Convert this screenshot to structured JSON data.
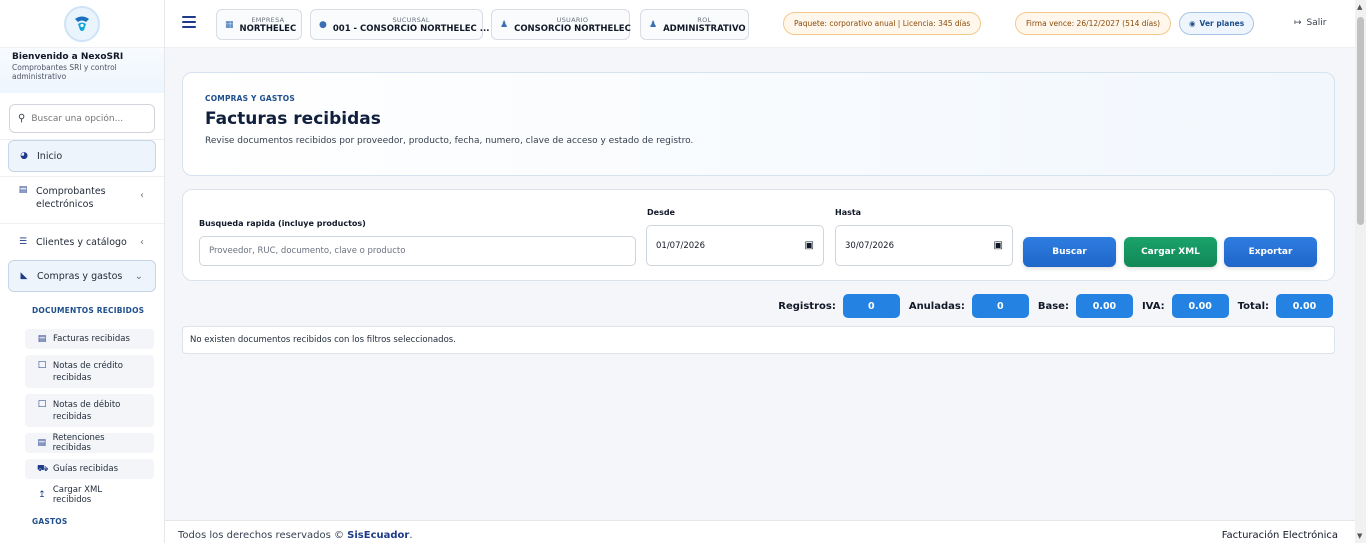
{
  "sidebar": {
    "welcome_title": "Bienvenido a NexoSRI",
    "welcome_subtitle": "Comprobantes SRI y control administrativo",
    "search_placeholder": "Buscar una opción...",
    "items": [
      {
        "label": "Inicio",
        "icon": "dashboard-icon"
      },
      {
        "label": "Comprobantes electrónicos",
        "icon": "document-icon"
      },
      {
        "label": "Clientes y catálogo",
        "icon": "list-icon"
      },
      {
        "label": "Compras y gastos",
        "icon": "cart-icon"
      }
    ],
    "section_received": "DOCUMENTOS RECIBIDOS",
    "sub_items": [
      {
        "label": "Facturas recibidas",
        "icon": "invoice-icon"
      },
      {
        "label": "Notas de crédito recibidas",
        "icon": "file-icon"
      },
      {
        "label": "Notas de débito recibidas",
        "icon": "file-icon"
      },
      {
        "label": "Retenciones recibidas",
        "icon": "invoice-icon"
      },
      {
        "label": "Guías recibidas",
        "icon": "truck-icon"
      },
      {
        "label": "Cargar XML recibidos",
        "icon": "upload-icon"
      }
    ],
    "section_expenses": "GASTOS"
  },
  "topbar": {
    "empresa_label": "EMPRESA",
    "empresa_value": "NORTHELEC",
    "sucursal_label": "SUCURSAL",
    "sucursal_value": "001 - CONSORCIO NORTHELEC ...",
    "usuario_label": "USUARIO",
    "usuario_value": "CONSORCIO NORTHELEC",
    "rol_label": "ROL",
    "rol_value": "ADMINISTRATIVO",
    "package_badge": "Paquete: corporativo anual | Licencia: 345 días",
    "signature_badge": "Firma vence: 26/12/2027 (514 días)",
    "plans_button": "Ver planes",
    "logout": "Salir"
  },
  "page": {
    "eyebrow": "COMPRAS Y GASTOS",
    "title": "Facturas recibidas",
    "description": "Revise documentos recibidos por proveedor, producto, fecha, numero, clave de acceso y estado de registro."
  },
  "filters": {
    "search_label": "Busqueda rapida (incluye productos)",
    "search_placeholder": "Proveedor, RUC, documento, clave o producto",
    "from_label": "Desde",
    "from_value": "01/07/2026",
    "to_label": "Hasta",
    "to_value": "30/07/2026",
    "search_button": "Buscar",
    "xml_button": "Cargar XML",
    "export_button": "Exportar"
  },
  "stats": {
    "records_label": "Registros:",
    "records_value": "0",
    "void_label": "Anuladas:",
    "void_value": "0",
    "base_label": "Base:",
    "base_value": "0.00",
    "iva_label": "IVA:",
    "iva_value": "0.00",
    "total_label": "Total:",
    "total_value": "0.00"
  },
  "empty_message": "No existen documentos recibidos con los filtros seleccionados.",
  "footer": {
    "rights": "Todos los derechos reservados ©",
    "brand": "SisEcuador",
    "right_text": "Facturación Electrónica"
  }
}
